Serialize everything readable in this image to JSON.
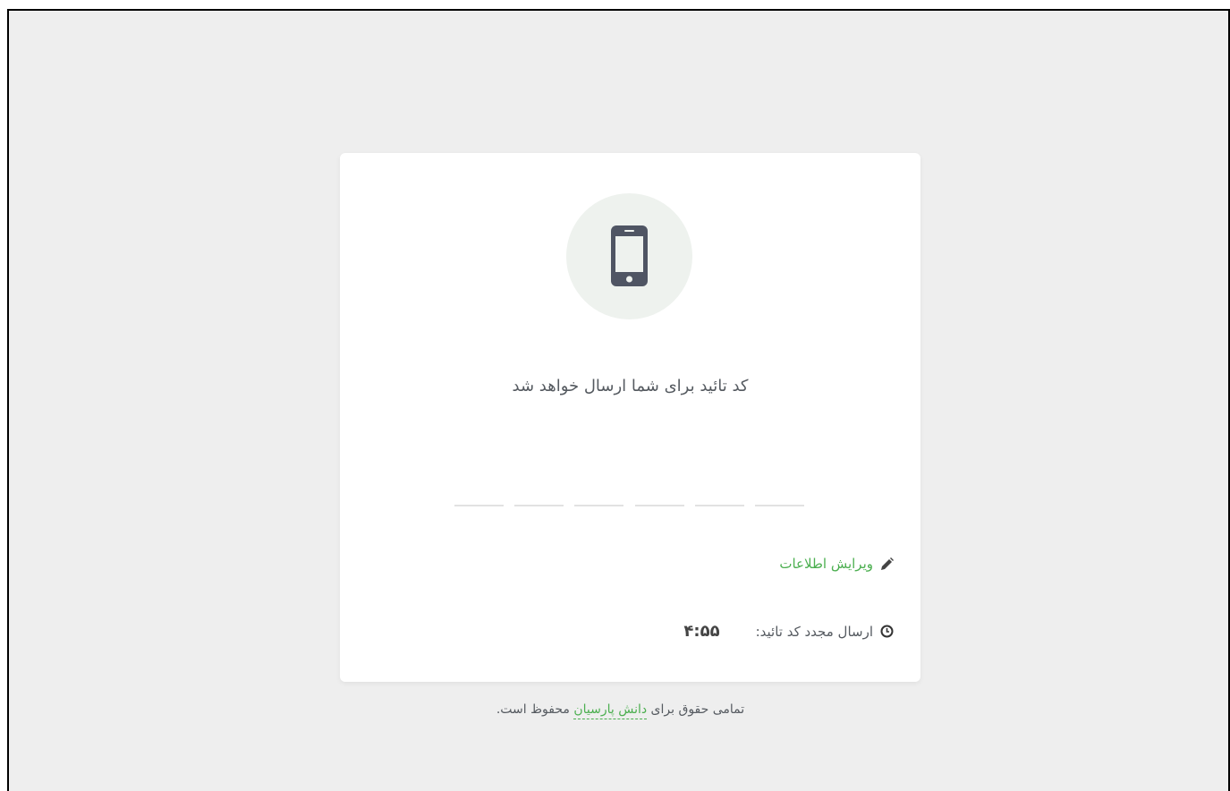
{
  "card": {
    "title": "کد تائید برای شما ارسال خواهد شد",
    "icon": "mobile-phone-icon",
    "otp": {
      "slots": 6
    },
    "edit_label": "ویرایش اطلاعات",
    "edit_icon": "pencil-icon",
    "resend_label": "ارسال مجدد کد تائید:",
    "resend_icon": "clock-icon",
    "timer": "۴:۵۵"
  },
  "footer": {
    "prefix": "تمامی حقوق برای",
    "brand": "دانش پارسیان",
    "suffix": "محفوظ است."
  },
  "colors": {
    "background": "#eeeeee",
    "card": "#ffffff",
    "accent": "#4caf50",
    "icon_circle": "#eef2ee",
    "icon": "#4f5563",
    "text": "#555a60"
  }
}
